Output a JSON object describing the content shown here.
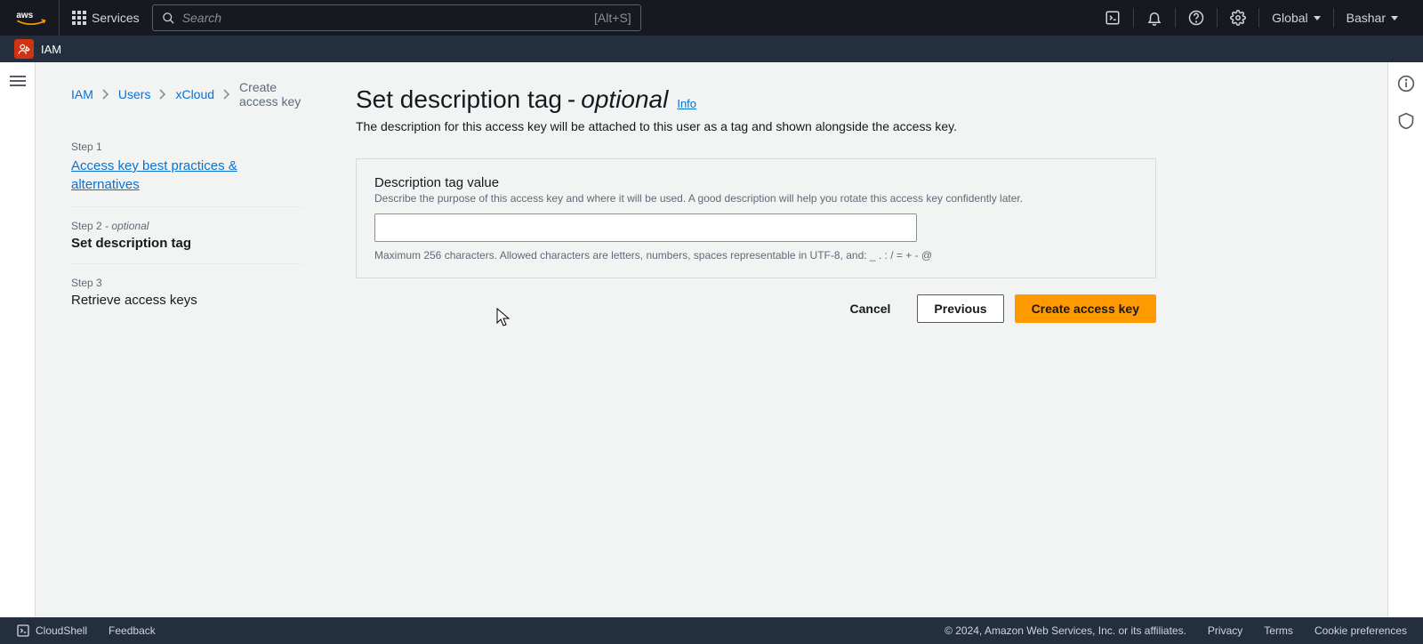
{
  "top": {
    "services_label": "Services",
    "search_placeholder": "Search",
    "search_shortcut": "[Alt+S]",
    "region": "Global",
    "user": "Bashar"
  },
  "service_bar": {
    "service": "IAM"
  },
  "breadcrumb": {
    "items": [
      "IAM",
      "Users",
      "xCloud",
      "Create access key"
    ]
  },
  "steps": {
    "s1_label": "Step 1",
    "s1_title": "Access key best practices & alternatives",
    "s2_label": "Step 2",
    "s2_opt": "- optional",
    "s2_title": "Set description tag",
    "s3_label": "Step 3",
    "s3_title": "Retrieve access keys"
  },
  "page": {
    "title_main": "Set description tag",
    "title_dash": " - ",
    "title_opt": "optional",
    "info": "Info",
    "desc": "The description for this access key will be attached to this user as a tag and shown alongside the access key."
  },
  "field": {
    "label": "Description tag value",
    "help": "Describe the purpose of this access key and where it will be used. A good description will help you rotate this access key confidently later.",
    "value": "",
    "hint": "Maximum 256 characters. Allowed characters are letters, numbers, spaces representable in UTF-8, and: _ . : / = + - @"
  },
  "actions": {
    "cancel": "Cancel",
    "previous": "Previous",
    "create": "Create access key"
  },
  "footer": {
    "cloudshell": "CloudShell",
    "feedback": "Feedback",
    "copyright": "© 2024, Amazon Web Services, Inc. or its affiliates.",
    "privacy": "Privacy",
    "terms": "Terms",
    "cookies": "Cookie preferences"
  }
}
